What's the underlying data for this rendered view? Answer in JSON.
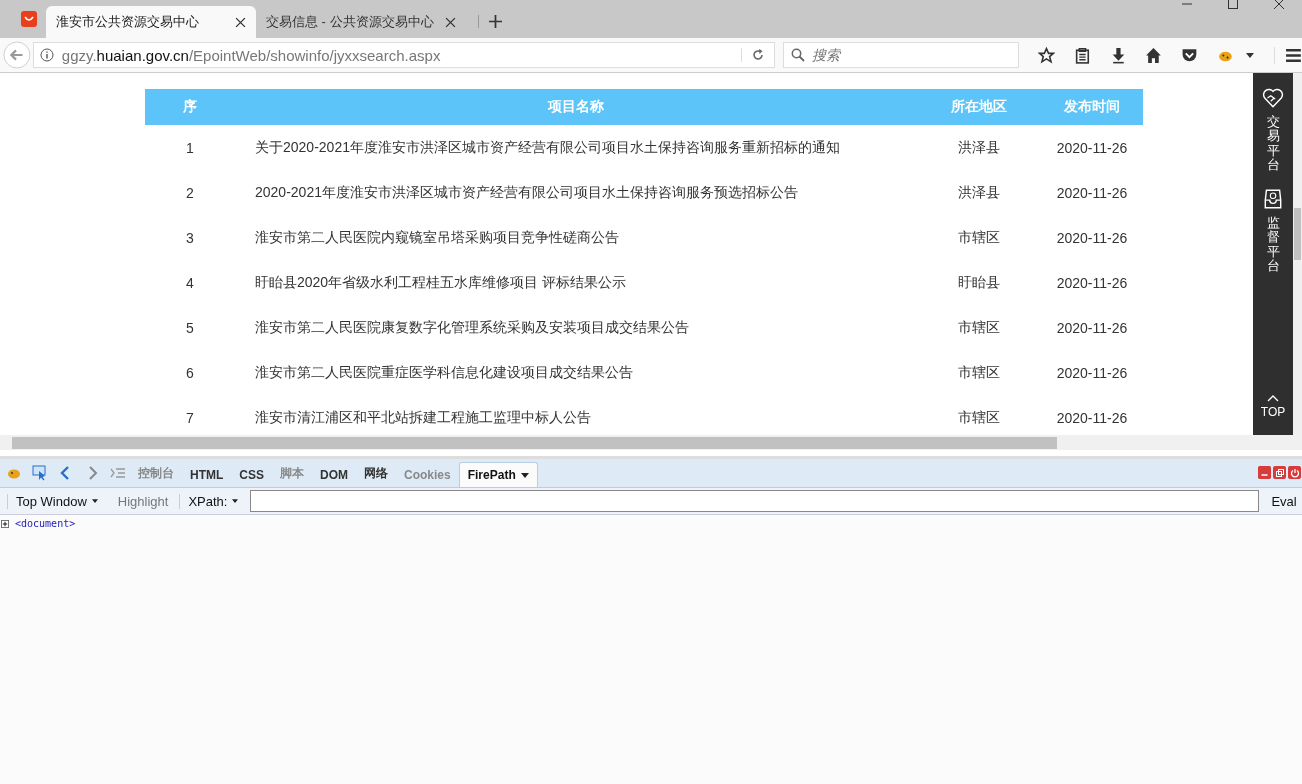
{
  "browser_tabs": [
    {
      "title": "淮安市公共资源交易中心",
      "selected": true
    },
    {
      "title": "交易信息 - 公共资源交易中心",
      "selected": false
    }
  ],
  "address_bar": {
    "prefix": "ggzy.",
    "domain": "huaian.gov.cn",
    "path": "/EpointWeb/showinfo/jyxxsearch.aspx"
  },
  "search": {
    "placeholder": "搜索"
  },
  "table": {
    "columns": [
      "序",
      "项目名称",
      "所在地区",
      "发布时间"
    ],
    "rows": [
      [
        "1",
        "关于2020-2021年度淮安市洪泽区城市资产经营有限公司项目水土保持咨询服务重新招标的通知",
        "洪泽县",
        "2020-11-26"
      ],
      [
        "2",
        "2020-2021年度淮安市洪泽区城市资产经营有限公司项目水土保持咨询服务预选招标公告",
        "洪泽县",
        "2020-11-26"
      ],
      [
        "3",
        "淮安市第二人民医院内窥镜室吊塔采购项目竞争性磋商公告",
        "市辖区",
        "2020-11-26"
      ],
      [
        "4",
        "盱眙县2020年省级水利工程桂五水库维修项目 评标结果公示",
        "盱眙县",
        "2020-11-26"
      ],
      [
        "5",
        "淮安市第二人民医院康复数字化管理系统采购及安装项目成交结果公告",
        "市辖区",
        "2020-11-26"
      ],
      [
        "6",
        "淮安市第二人民医院重症医学科信息化建设项目成交结果公告",
        "市辖区",
        "2020-11-26"
      ],
      [
        "7",
        "淮安市清江浦区和平北站拆建工程施工监理中标人公告",
        "市辖区",
        "2020-11-26"
      ]
    ]
  },
  "side_panel": {
    "items": [
      {
        "kind": "trade",
        "label": "交易平台"
      },
      {
        "kind": "supervise",
        "label": "监督平台"
      }
    ],
    "top": "TOP"
  },
  "devtools": {
    "panels": [
      {
        "label": "控制台",
        "disabled": true,
        "selected": false
      },
      {
        "label": "HTML",
        "disabled": false,
        "selected": false
      },
      {
        "label": "CSS",
        "disabled": false,
        "selected": false
      },
      {
        "label": "脚本",
        "disabled": true,
        "selected": false
      },
      {
        "label": "DOM",
        "disabled": false,
        "selected": false
      },
      {
        "label": "网络",
        "disabled": false,
        "selected": false
      },
      {
        "label": "Cookies",
        "disabled": true,
        "selected": false
      },
      {
        "label": "FirePath",
        "disabled": false,
        "selected": true
      }
    ],
    "window_menu": "Top Window",
    "highlight": "Highlight",
    "xpath_label": "XPath:",
    "eval": "Eval",
    "tree_node": "<document>"
  }
}
